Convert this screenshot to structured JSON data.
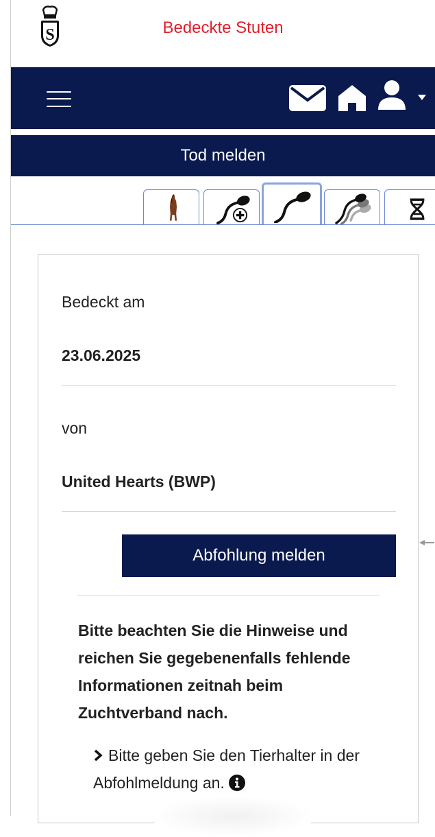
{
  "header": {
    "title": "Bedeckte Stuten",
    "logo": "studbook-crown-s-logo"
  },
  "navbar": {
    "icons": [
      "hamburger-menu-icon",
      "envelope-icon",
      "home-icon",
      "user-icon",
      "caret-down-icon"
    ]
  },
  "actions": {
    "report_death": "Tod melden",
    "report_foaling": "Abfohlung melden"
  },
  "tabs": [
    {
      "icon": "horse-icon",
      "active": false
    },
    {
      "icon": "sperm-plus-icon",
      "active": false
    },
    {
      "icon": "sperm-icon",
      "active": true
    },
    {
      "icon": "sperm-multiple-icon",
      "active": false
    },
    {
      "icon": "dna-icon",
      "active": false
    }
  ],
  "details": {
    "covered_label": "Bedeckt am",
    "covered_date": "23.06.2025",
    "by_label": "von",
    "stallion": "United Hearts (BWP)"
  },
  "notice": {
    "text": "Bitte beachten Sie die Hinweise und reichen Sie gegebenenfalls fehlende Informationen zeitnah beim Zuchtverband nach.",
    "hint": "Bitte geben Sie den Tierhalter in der Abfohlmeldung an."
  },
  "colors": {
    "navy": "#0a1a4e",
    "title_red": "#e21e2b",
    "tab_border": "#6a8ad6"
  }
}
